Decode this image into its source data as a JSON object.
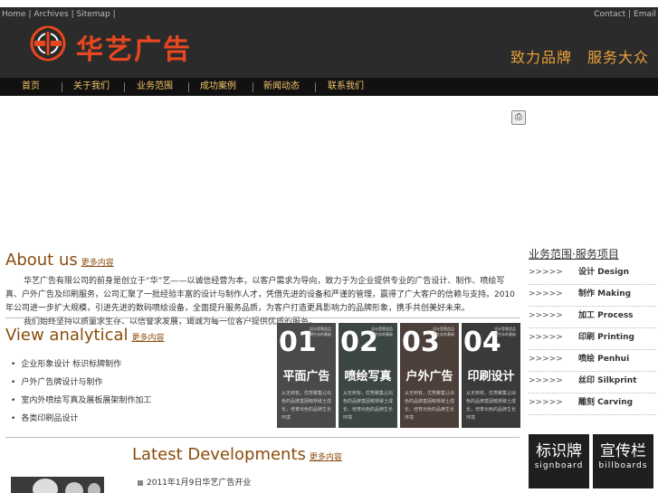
{
  "topbar": {
    "home": "Home",
    "archives": "Archives",
    "sitemap": "Sitemap",
    "contact": "Contact",
    "email": "Email"
  },
  "header": {
    "logo_text": "华艺广告",
    "slogan": "致力品牌　服务大众"
  },
  "nav": {
    "items": [
      "首页",
      "关于我们",
      "业务范围",
      "成功案例",
      "新闻动态",
      "联系我们"
    ]
  },
  "about": {
    "title": "About us",
    "more": "更多内容",
    "text": "华艺广告有限公司的前身是创立于“华”艺——以诚信经营为本，以客户需求为导向，致力于为企业提供专业的广告设计、制作、喷绘写真、户外广告及印刷服务，公司汇聚了一批经验丰富的设计与制作人才，凭借先进的设备和严谨的管理，赢得了广大客户的信赖与支持。2010年公司进一步扩大规模，引进先进的数码喷绘设备，全面提升服务品质，为客户打造更具影响力的品牌形象，携手共创美好未来。",
    "text2": "我们始终坚持以质量求生存、以信誉求发展，竭诚为每一位客户提供优质的服务。"
  },
  "view": {
    "title": "View analytical",
    "more": "更多内容",
    "items": [
      "企业形象设计 标识标牌制作",
      "户外广告牌设计与制作",
      "室内外喷绘写真及展板展架制作加工",
      "各类印刷品设计"
    ]
  },
  "tiles": [
    {
      "num": "01",
      "label": "平面广告",
      "mini": "设计是营造品牌生存的基础",
      "desc": "从无到有，优势聚集让出色的品牌基因萌芽破土成长，培育出色的品牌生长环境"
    },
    {
      "num": "02",
      "label": "喷绘写真",
      "mini": "设计是营造品牌生存的基础",
      "desc": "从无到有，优势聚集让出色的品牌基因萌芽破土成长，培育出色的品牌生长环境"
    },
    {
      "num": "03",
      "label": "户外广告",
      "mini": "设计是营造品牌生存的基础",
      "desc": "从无到有，优势聚集让出色的品牌基因萌芽破土成长，培育出色的品牌生长环境"
    },
    {
      "num": "04",
      "label": "印刷设计",
      "mini": "设计是营造品牌生存的基础",
      "desc": "从无到有，优势聚集让出色的品牌基因萌芽破土成长，培育出色的品牌生长环境"
    }
  ],
  "side": {
    "title": "业务范围·服务项目",
    "arrow": ">>>>>",
    "items": [
      {
        "cn": "设计",
        "en": "Design"
      },
      {
        "cn": "制作",
        "en": "Making"
      },
      {
        "cn": "加工",
        "en": "Process"
      },
      {
        "cn": "印刷",
        "en": "Printing"
      },
      {
        "cn": "喷绘",
        "en": "Penhui"
      },
      {
        "cn": "丝印",
        "en": "Silkprint"
      },
      {
        "cn": "雕刻",
        "en": "Carving"
      }
    ]
  },
  "promos": [
    {
      "cn": "标识牌",
      "en": "signboard"
    },
    {
      "cn": "宣传栏",
      "en": "billboards"
    }
  ],
  "latest": {
    "title": "Latest Developments",
    "more": "更多内容",
    "item": "2011年1月9日华艺广告开业"
  },
  "colors": {
    "header_bg": "#2b2b2b",
    "nav_bg": "#111111",
    "nav_text": "#f2c36b",
    "logo_red": "#e8471f",
    "slogan_orange": "#e8a03a",
    "title_brown": "#8a4c0c"
  }
}
